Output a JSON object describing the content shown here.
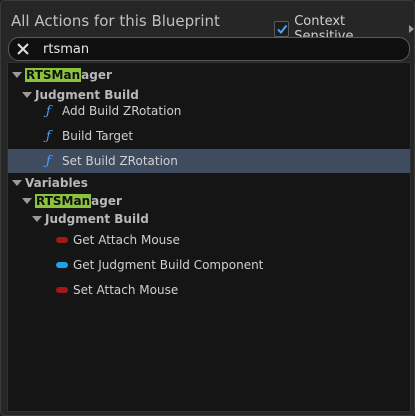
{
  "header": {
    "title": "All Actions for this Blueprint",
    "context_label": "Context Sensitive",
    "context_checked": true
  },
  "search": {
    "value": "rtsman",
    "placeholder": ""
  },
  "tree": {
    "category1": {
      "highlight": "RTSMan",
      "rest": "ager"
    },
    "subcategory1": "Judgment Build",
    "functions": [
      "Add Build ZRotation",
      "Build Target",
      "Set Build ZRotation"
    ],
    "variables_label": "Variables",
    "category2": {
      "highlight": "RTSMan",
      "rest": "ager"
    },
    "subcategory2": "Judgment Build",
    "variable_items": [
      {
        "label": "Get Attach Mouse",
        "color": "#a01818"
      },
      {
        "label": "Get Judgment Build Component",
        "color": "#1aa3e8"
      },
      {
        "label": "Set Attach Mouse",
        "color": "#a01818"
      }
    ]
  },
  "colors": {
    "highlight": "#8cc33c",
    "selected_row": "#3f4b5e",
    "function_icon": "#4aa3ff"
  }
}
